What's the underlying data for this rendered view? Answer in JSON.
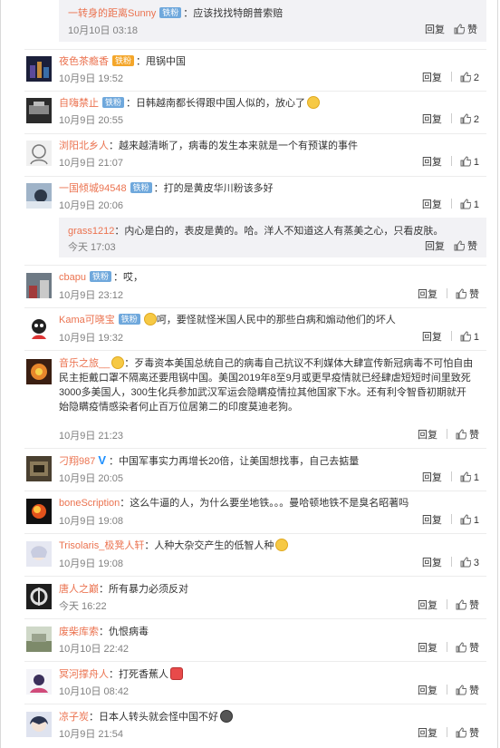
{
  "top_reply": {
    "user": "一转身的距离Sunny",
    "badge": "铁粉",
    "text": "：应该找找特朗普索赔",
    "time": "10月10日 03:18",
    "reply": "回复",
    "like": "赞"
  },
  "comments": [
    {
      "user": "夜色茶瘾香",
      "badge": "铁粉",
      "badge_color": "gold",
      "text": "：甩锅中国",
      "time": "10月9日 19:52",
      "reply": "回复",
      "like": "2"
    },
    {
      "user": "自嗨禁止",
      "badge": "铁粉",
      "text": "：日韩越南都长得跟中国人似的，放心了",
      "emoji": "smile",
      "time": "10月9日 20:55",
      "reply": "回复",
      "like": "2"
    },
    {
      "user": "浏阳北乡人",
      "text": "：越来越清晰了，病毒的发生本来就是一个有预谋的事件",
      "time": "10月9日 21:07",
      "reply": "回复",
      "like": "1"
    },
    {
      "user": "一国倾城94548",
      "badge": "铁粉",
      "text": "：打的是黄皮华川粉该多好",
      "time": "10月9日 20:06",
      "reply": "回复",
      "like": "1"
    },
    {
      "user": "cbapu",
      "badge": "铁粉",
      "text": "：哎，",
      "time": "10月9日 23:12",
      "reply": "回复",
      "like": "赞"
    },
    {
      "user": "Kama可晓宝",
      "badge": "铁粉",
      "text": "呵，要怪就怪米国人民中的那些白病和煽动他们的坏人",
      "emoji_before": "smile",
      "time": "10月9日 19:32",
      "reply": "回复",
      "like": "1"
    },
    {
      "user": "音乐之旅__",
      "text": "：歹毒资本美国总统自己的病毒自己抗议不利媒体大肆宣传新冠病毒不可怕自由民主拒戴口罩不隔离还要甩锅中国。美国2019年8至9月或更早疫情就已经肆虐短短时间里致死3000多美国人，300生化兵参加武汉军运会隐瞒疫情拉其他国家下水。还有利令智昏初期就开始隐瞒疫情感染者何止百万位居第二的印度莫迪老狗。",
      "time": "10月9日 21:23",
      "reply": "回复",
      "like": "赞"
    },
    {
      "user": "刁翔987",
      "text": "：中国军事实力再增长20倍，让美国想找事，自己去掂量",
      "time": "10月9日 20:05",
      "reply": "回复",
      "like": "1"
    },
    {
      "user": "boneScription",
      "text": "：这么牛逼的人，为什么要坐地铁。。。曼哈顿地铁不是臭名昭著吗",
      "time": "10月9日 19:08",
      "reply": "回复",
      "like": "1"
    },
    {
      "user": "Trisolaris_极凳人轩",
      "text": "：人种大杂交产生的低智人种",
      "emoji": "smile",
      "time": "10月9日 19:08",
      "reply": "回复",
      "like": "3"
    },
    {
      "user": "唐人之巅",
      "text": "：所有暴力必须反对",
      "time": "今天 16:22",
      "reply": "回复",
      "like": "赞"
    },
    {
      "user": "废柴库索",
      "text": "：仇恨病毒",
      "time": "10月10日 22:42",
      "reply": "回复",
      "like": "赞"
    },
    {
      "user": "冥河撑舟人",
      "text": "：打死香蕉人",
      "emoji": "cake",
      "time": "10月10日 08:42",
      "reply": "回复",
      "like": "赞"
    },
    {
      "user": "凉子炭",
      "text": "：日本人转头就会怪中国不好",
      "emoji": "dark",
      "time": "10月9日 21:54",
      "reply": "回复",
      "like": "赞"
    }
  ],
  "sub_reply": {
    "user": "grass1212",
    "text": "：内心是白的，表皮是黄的。哈。洋人不知道这人有蒸美之心，只看皮肤。",
    "time": "今天 17:03",
    "reply": "回复",
    "like": "赞"
  },
  "colors": {
    "username": "#eb7350",
    "badge": "#6fa8dc",
    "badge_gold": "#f4a62a",
    "time": "#808080",
    "subbox_bg": "#f2f2f5"
  }
}
